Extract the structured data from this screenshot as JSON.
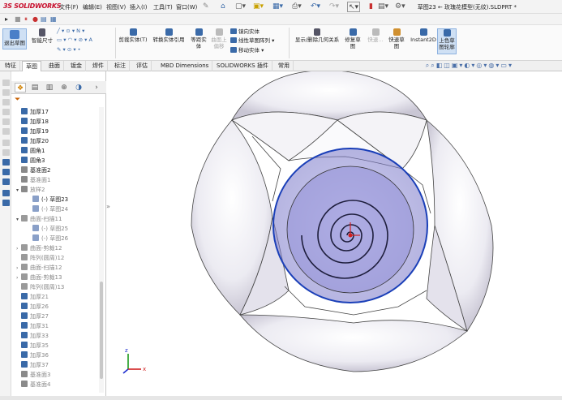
{
  "app": {
    "logo_text": "SOLIDWORKS",
    "logo_prefix": "3S"
  },
  "menu": [
    "文件(F)",
    "编辑(E)",
    "视图(V)",
    "插入(I)",
    "工具(T)",
    "窗口(W)"
  ],
  "title": "草图23 ← 玫瑰花模型(无纹).SLDPRT *",
  "ribbon": {
    "exit_sketch": "退出草图",
    "smart_dim": "智能尺寸",
    "trim": "剪裁实体(T)",
    "convert": "转换实体引用",
    "offset": "等距实体",
    "offset2": "曲面上偏移",
    "mirror": "镜向实体",
    "linear_pattern": "线性草图阵列",
    "move": "移动实体",
    "display_relations": "显示/删除几何关系",
    "repair": "修复草图",
    "quick_snaps": "快速...",
    "rapid_sketch": "快速草图",
    "instant2d": "Instant2D",
    "shaded_contours": "上色草图轮廓"
  },
  "tabs": [
    "特征",
    "草图",
    "曲面",
    "钣金",
    "焊件",
    "标注",
    "评估",
    "MBD Dimensions",
    "SOLIDWORKS 插件",
    "常用"
  ],
  "active_tab": "草图",
  "tree": [
    {
      "label": "加厚17",
      "icon": "thicken",
      "dim": false,
      "arrow": ""
    },
    {
      "label": "加厚18",
      "icon": "thicken",
      "dim": false,
      "arrow": ""
    },
    {
      "label": "加厚19",
      "icon": "thicken",
      "dim": false,
      "arrow": ""
    },
    {
      "label": "加厚20",
      "icon": "thicken",
      "dim": false,
      "arrow": ""
    },
    {
      "label": "圆角1",
      "icon": "fillet",
      "dim": false,
      "arrow": ""
    },
    {
      "label": "圆角3",
      "icon": "fillet",
      "dim": false,
      "arrow": ""
    },
    {
      "label": "基准面2",
      "icon": "plane",
      "dim": false,
      "arrow": ""
    },
    {
      "label": "基准面1",
      "icon": "plane",
      "dim": true,
      "arrow": ""
    },
    {
      "label": "放样2",
      "icon": "loft",
      "dim": true,
      "arrow": "▾"
    },
    {
      "label": "(-) 草图23",
      "icon": "sketch",
      "dim": false,
      "arrow": "",
      "indent": true
    },
    {
      "label": "(-) 草图24",
      "icon": "sketch",
      "dim": true,
      "arrow": "",
      "indent": true
    },
    {
      "label": "曲面-扫描11",
      "icon": "surface",
      "dim": true,
      "arrow": "▾"
    },
    {
      "label": "(-) 草图25",
      "icon": "sketch",
      "dim": true,
      "arrow": "",
      "indent": true
    },
    {
      "label": "(-) 草图26",
      "icon": "sketch",
      "dim": true,
      "arrow": "",
      "indent": true
    },
    {
      "label": "曲面-剪裁12",
      "icon": "surface",
      "dim": true,
      "arrow": "›"
    },
    {
      "label": "阵列(圆周)12",
      "icon": "pattern",
      "dim": true,
      "arrow": ""
    },
    {
      "label": "曲面-扫描12",
      "icon": "surface",
      "dim": true,
      "arrow": "›"
    },
    {
      "label": "曲面-剪裁13",
      "icon": "surface",
      "dim": true,
      "arrow": "›"
    },
    {
      "label": "阵列(圆周)13",
      "icon": "pattern",
      "dim": true,
      "arrow": ""
    },
    {
      "label": "加厚21",
      "icon": "thicken",
      "dim": true,
      "arrow": ""
    },
    {
      "label": "加厚26",
      "icon": "thicken",
      "dim": true,
      "arrow": ""
    },
    {
      "label": "加厚27",
      "icon": "thicken",
      "dim": true,
      "arrow": ""
    },
    {
      "label": "加厚31",
      "icon": "thicken",
      "dim": true,
      "arrow": ""
    },
    {
      "label": "加厚33",
      "icon": "thicken",
      "dim": true,
      "arrow": ""
    },
    {
      "label": "加厚35",
      "icon": "thicken",
      "dim": true,
      "arrow": ""
    },
    {
      "label": "加厚36",
      "icon": "thicken",
      "dim": true,
      "arrow": ""
    },
    {
      "label": "加厚37",
      "icon": "thicken",
      "dim": true,
      "arrow": ""
    },
    {
      "label": "基准面3",
      "icon": "plane",
      "dim": true,
      "arrow": ""
    },
    {
      "label": "基准面4",
      "icon": "plane",
      "dim": true,
      "arrow": ""
    }
  ],
  "triad": {
    "x": "x",
    "y": "y",
    "z": "z"
  },
  "colors": {
    "accent": "#1a3fb8",
    "sketch_fill": "#8a8ad8",
    "petal": "#e8e6ee"
  }
}
